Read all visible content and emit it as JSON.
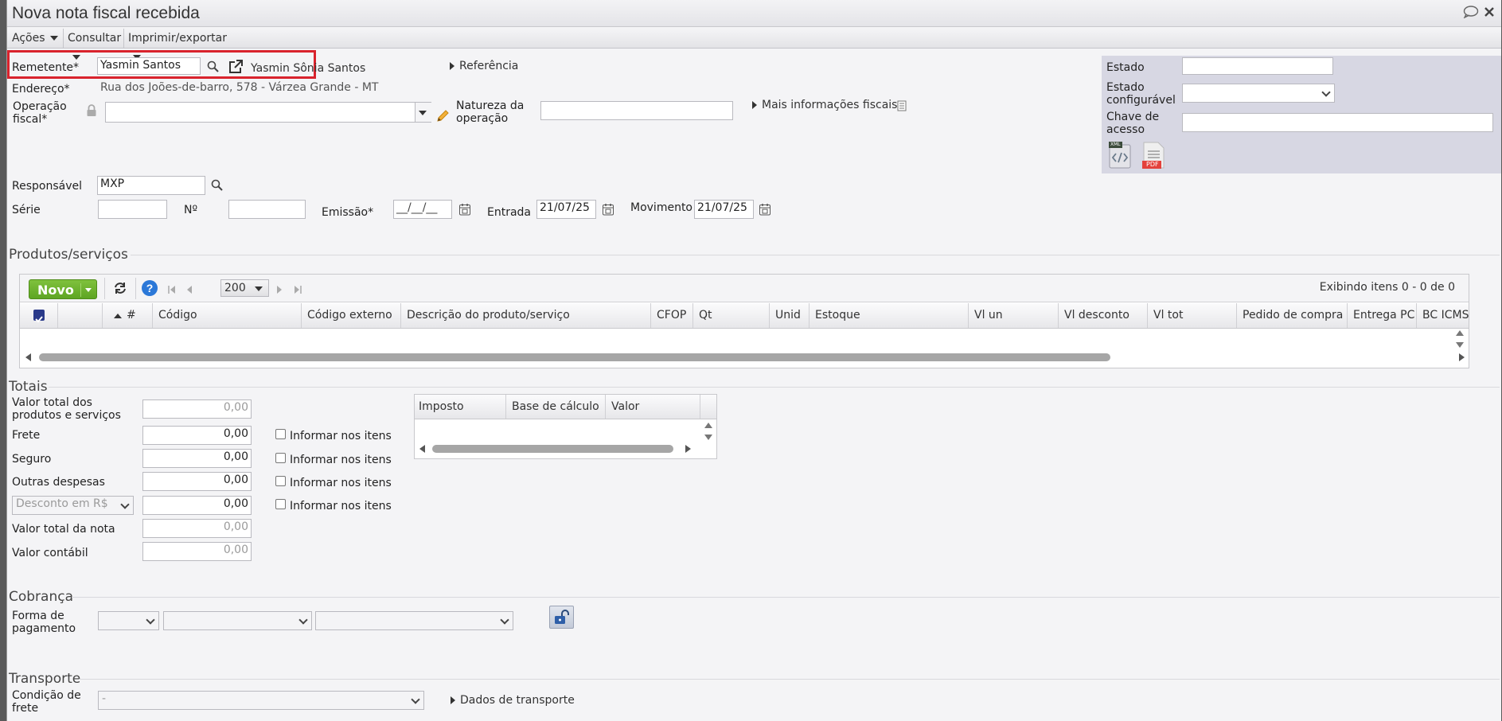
{
  "window": {
    "title": "Nova nota fiscal recebida"
  },
  "menubar": {
    "items": [
      "Ações",
      "Consultar",
      "Imprimir/exportar"
    ]
  },
  "header": {
    "remetente_label": "Remetente*",
    "remetente_value": "Yasmin Santos",
    "remetente_name": "Yasmin Sônia Santos",
    "referencia": "Referência",
    "endereco_label": "Endereço*",
    "endereco_value": "Rua dos Joões-de-barro, 578 - Várzea Grande - MT",
    "operacao_label_1": "Operação",
    "operacao_label_2": "fiscal*",
    "natureza_label_1": "Natureza da",
    "natureza_label_2": "operação",
    "mais_info": "Mais informações fiscais",
    "responsavel_label": "Responsável",
    "responsavel_value": "MXP",
    "serie_label": "Série",
    "numero_label": "Nº",
    "emissao_label": "Emissão*",
    "emissao_value": "__/__/__",
    "entrada_label": "Entrada",
    "entrada_value": "21/07/25",
    "movimento_label": "Movimento",
    "movimento_value": "21/07/25"
  },
  "side_panel": {
    "estado_label": "Estado",
    "estado_config_label_1": "Estado",
    "estado_config_label_2": "configurável",
    "chave_label_1": "Chave de",
    "chave_label_2": "acesso",
    "xml_badge": "XML",
    "pdf_badge": "PDF"
  },
  "produtos": {
    "section_title": "Produtos/serviços",
    "novo_button": "Novo",
    "page_size": "200",
    "display_info": "Exibindo itens 0 - 0 de 0",
    "columns": [
      "#",
      "Código",
      "Código externo",
      "Descrição do produto/serviço",
      "CFOP",
      "Qt",
      "Unid",
      "Estoque",
      "Vl un",
      "Vl desconto",
      "Vl tot",
      "Pedido de compra",
      "Entrega PC",
      "BC ICMS"
    ]
  },
  "totais": {
    "section_title": "Totais",
    "rows": [
      {
        "label_1": "Valor total dos",
        "label_2": "produtos e serviços",
        "value": "0,00"
      },
      {
        "label_1": "Frete",
        "value": "0,00",
        "check": "Informar nos itens"
      },
      {
        "label_1": "Seguro",
        "value": "0,00",
        "check": "Informar nos itens"
      },
      {
        "label_1": "Outras despesas",
        "value": "0,00",
        "check": "Informar nos itens"
      },
      {
        "label_1": "Desconto em R$",
        "value": "0,00",
        "check": "Informar nos itens"
      },
      {
        "label_1": "Valor total da nota",
        "value": "0,00"
      },
      {
        "label_1": "Valor contábil",
        "value": "0,00"
      }
    ],
    "tax_columns": [
      "Imposto",
      "Base de cálculo",
      "Valor"
    ]
  },
  "cobranca": {
    "section_title": "Cobrança",
    "forma_label_1": "Forma de",
    "forma_label_2": "pagamento"
  },
  "transporte": {
    "section_title": "Transporte",
    "condicao_label_1": "Condição de",
    "condicao_label_2": "frete",
    "condicao_value": "-",
    "dados": "Dados de transporte"
  }
}
